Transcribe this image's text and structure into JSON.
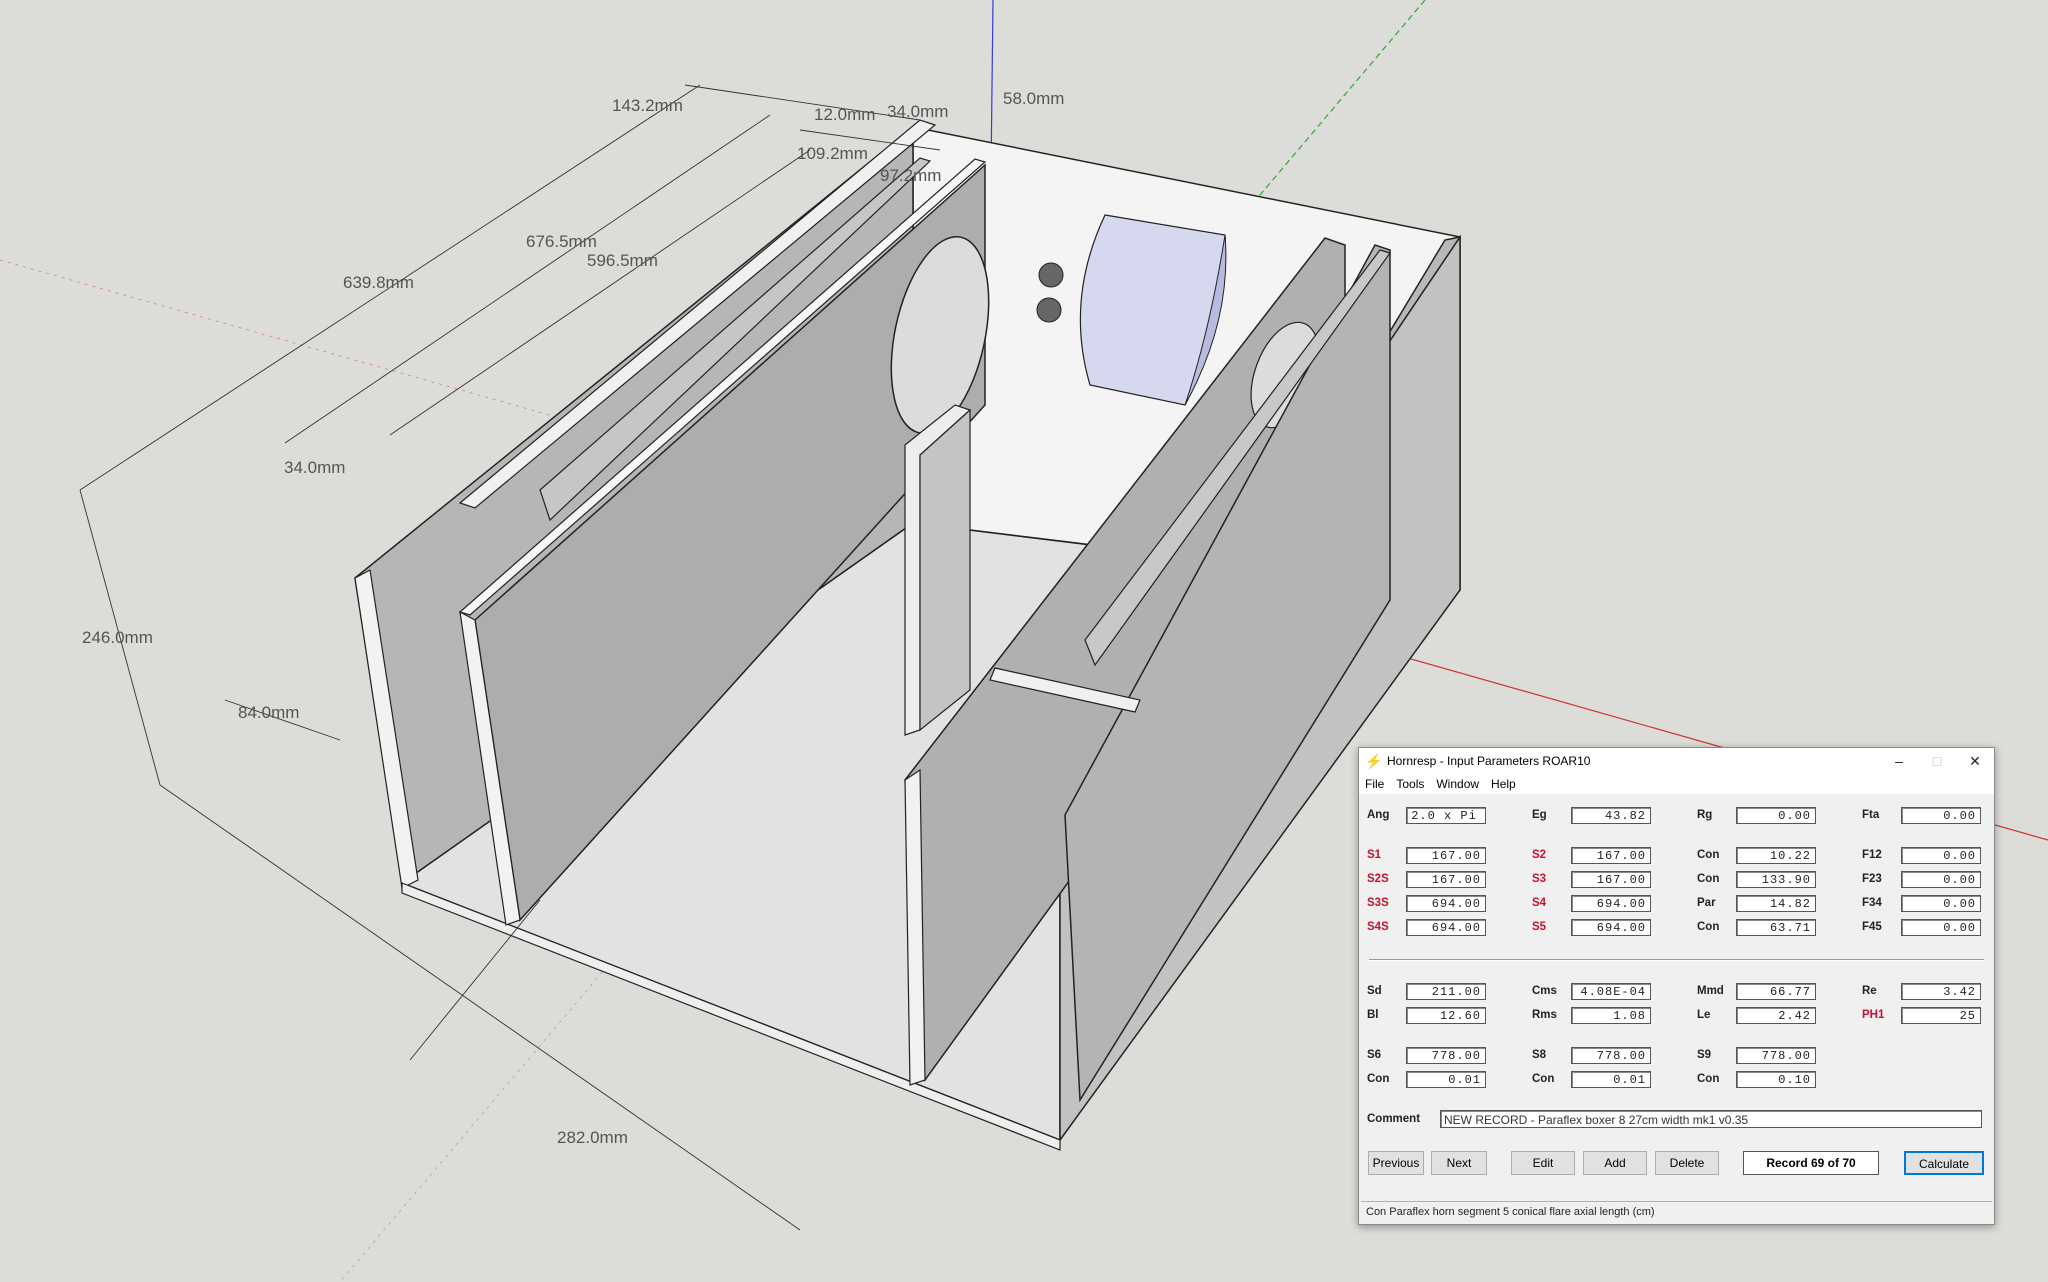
{
  "scene": {
    "dimensions": [
      "143.2mm",
      "12.0mm",
      "34.0mm",
      "58.0mm",
      "109.2mm",
      "97.2mm",
      "676.5mm",
      "596.5mm",
      "639.8mm",
      "34.0mm",
      "246.0mm",
      "84.0mm",
      "282.0mm"
    ]
  },
  "window": {
    "title": "Hornresp - Input Parameters   ROAR10",
    "minimize": "–",
    "maximize": "□",
    "close": "✕",
    "menu": [
      "File",
      "Tools",
      "Window",
      "Help"
    ]
  },
  "params": {
    "ang_label": "Ang",
    "ang_value": "2.0 x Pi",
    "eg_label": "Eg",
    "eg_value": "43.82",
    "rg_label": "Rg",
    "rg_value": "0.00",
    "fta_label": "Fta",
    "fta_value": "0.00",
    "rows": [
      {
        "a_label": "S1",
        "a_value": "167.00",
        "b_label": "S2",
        "b_value": "167.00",
        "c_label": "Con",
        "c_value": "10.22",
        "d_label": "F12",
        "d_value": "0.00"
      },
      {
        "a_label": "S2S",
        "a_value": "167.00",
        "b_label": "S3",
        "b_value": "167.00",
        "c_label": "Con",
        "c_value": "133.90",
        "d_label": "F23",
        "d_value": "0.00"
      },
      {
        "a_label": "S3S",
        "a_value": "694.00",
        "b_label": "S4",
        "b_value": "694.00",
        "c_label": "Par",
        "c_value": "14.82",
        "d_label": "F34",
        "d_value": "0.00"
      },
      {
        "a_label": "S4S",
        "a_value": "694.00",
        "b_label": "S5",
        "b_value": "694.00",
        "c_label": "Con",
        "c_value": "63.71",
        "d_label": "F45",
        "d_value": "0.00"
      }
    ],
    "sd_label": "Sd",
    "sd_value": "211.00",
    "cms_label": "Cms",
    "cms_value": "4.08E-04",
    "mmd_label": "Mmd",
    "mmd_value": "66.77",
    "re_label": "Re",
    "re_value": "3.42",
    "bl_label": "Bl",
    "bl_value": "12.60",
    "rms_label": "Rms",
    "rms_value": "1.08",
    "le_label": "Le",
    "le_value": "2.42",
    "ph1_label": "PH1",
    "ph1_value": "25",
    "s6_label": "S6",
    "s6_value": "778.00",
    "s8_label": "S8",
    "s8_value": "778.00",
    "s9_label": "S9",
    "s9_value": "778.00",
    "con6_label": "Con",
    "con6_value": "0.01",
    "con8_label": "Con",
    "con8_value": "0.01",
    "con9_label": "Con",
    "con9_value": "0.10",
    "comment_label": "Comment",
    "comment_value": "NEW RECORD - Paraflex boxer 8 27cm width mk1 v0.35"
  },
  "buttons": {
    "previous": "Previous",
    "next": "Next",
    "edit": "Edit",
    "add": "Add",
    "delete": "Delete",
    "record": "Record 69 of 70",
    "calculate": "Calculate"
  },
  "status": "Con   Paraflex horn segment 5 conical flare axial length  (cm)"
}
